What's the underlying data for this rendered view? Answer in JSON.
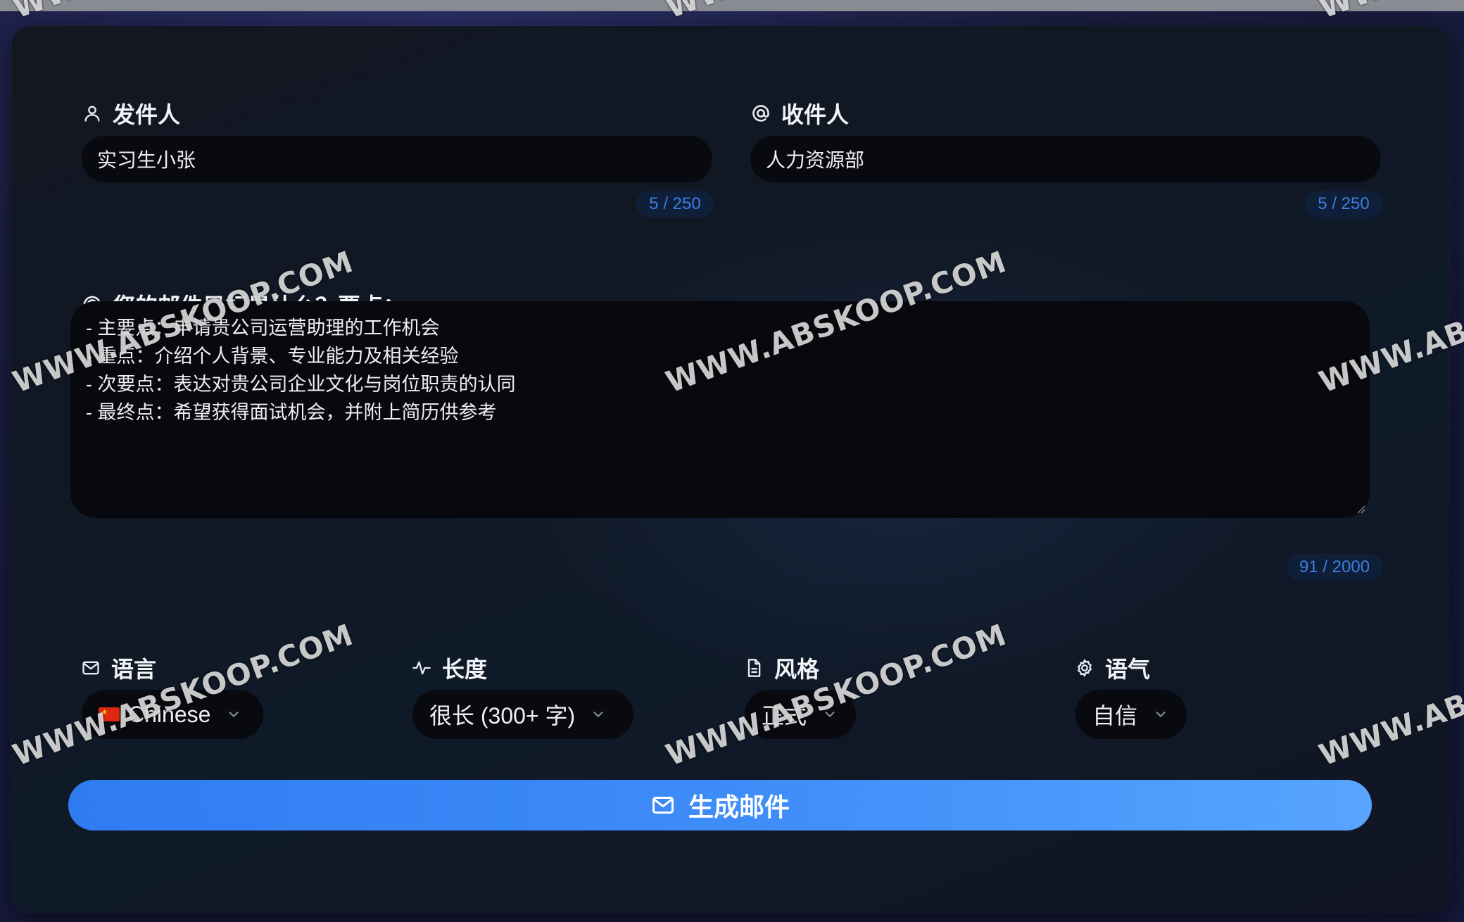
{
  "sender": {
    "label": "发件人",
    "value": "实习生小张",
    "counter": "5 / 250",
    "icon": "user-icon"
  },
  "recipient": {
    "label": "收件人",
    "value": "人力资源部",
    "counter": "5 / 250",
    "icon": "at-sign-icon"
  },
  "goal": {
    "label": "您的邮件目标是什么？要点：",
    "icon": "target-icon",
    "lines": [
      "- 主要点：申请贵公司运营助理的工作机会",
      "- 重点：介绍个人背景、专业能力及相关经验",
      "- 次要点：表达对贵公司企业文化与岗位职责的认同",
      "- 最终点：希望获得面试机会，并附上简历供参考"
    ],
    "counter": "91 / 2000"
  },
  "options": {
    "language": {
      "label": "语言",
      "value": "Chinese",
      "icon": "mail-icon"
    },
    "length": {
      "label": "长度",
      "value": "很长 (300+ 字)",
      "icon": "activity-icon"
    },
    "style": {
      "label": "风格",
      "value": "正式",
      "icon": "document-icon"
    },
    "tone": {
      "label": "语气",
      "value": "自信",
      "icon": "gear-icon"
    }
  },
  "generate_button": {
    "label": "生成邮件",
    "icon": "mail-icon"
  },
  "watermark": {
    "text": "WWW.ABSKOOP.COM"
  },
  "colors": {
    "accent": "#3d8cf8",
    "counter_text": "#3d7fe0",
    "field_bg": "#080a10"
  }
}
